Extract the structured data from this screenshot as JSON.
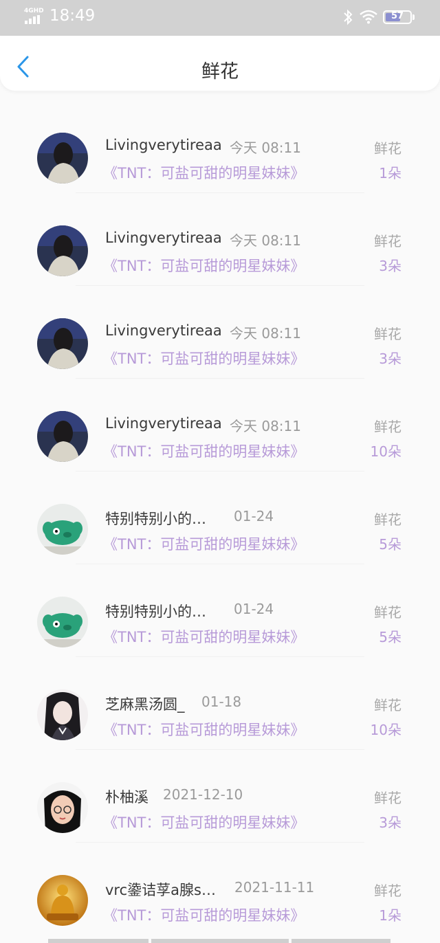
{
  "status_bar": {
    "network": "4GHD",
    "time": "18:49",
    "battery_level": "57"
  },
  "header": {
    "title": "鲜花"
  },
  "records": [
    {
      "username": "Livingverytireaa",
      "date": "今天 08:11",
      "work": "《TNT：可盐可甜的明星妹妹》",
      "gift_type": "鲜花",
      "count": "1朵",
      "avatar": "dark-hair-portrait"
    },
    {
      "username": "Livingverytireaa",
      "date": "今天 08:11",
      "work": "《TNT：可盐可甜的明星妹妹》",
      "gift_type": "鲜花",
      "count": "3朵",
      "avatar": "dark-hair-portrait"
    },
    {
      "username": "Livingverytireaa",
      "date": "今天 08:11",
      "work": "《TNT：可盐可甜的明星妹妹》",
      "gift_type": "鲜花",
      "count": "3朵",
      "avatar": "dark-hair-portrait"
    },
    {
      "username": "Livingverytireaa",
      "date": "今天 08:11",
      "work": "《TNT：可盐可甜的明星妹妹》",
      "gift_type": "鲜花",
      "count": "10朵",
      "avatar": "dark-hair-portrait"
    },
    {
      "username": "特别特别小的…",
      "date": "01-24",
      "work": "《TNT：可盐可甜的明星妹妹》",
      "gift_type": "鲜花",
      "count": "5朵",
      "avatar": "green-clay-figure"
    },
    {
      "username": "特别特别小的…",
      "date": "01-24",
      "work": "《TNT：可盐可甜的明星妹妹》",
      "gift_type": "鲜花",
      "count": "5朵",
      "avatar": "green-clay-figure"
    },
    {
      "username": "芝麻黑汤圆_",
      "date": "01-18",
      "work": "《TNT：可盐可甜的明星妹妹》",
      "gift_type": "鲜花",
      "count": "10朵",
      "avatar": "girl-selfie"
    },
    {
      "username": "朴柚溪",
      "date": "2021-12-10",
      "work": "《TNT：可盐可甜的明星妹妹》",
      "gift_type": "鲜花",
      "count": "3朵",
      "avatar": "glasses-portrait"
    },
    {
      "username": "vrc鍌诘莩a腺s…",
      "date": "2021-11-11",
      "work": "《TNT：可盐可甜的明星妹妹》",
      "gift_type": "鲜花",
      "count": "1朵",
      "avatar": "golden-buddha"
    }
  ],
  "colors": {
    "accent_purple": "#b79ad8",
    "back_blue": "#2b96e8",
    "status_gray": "#d2d2d2"
  }
}
